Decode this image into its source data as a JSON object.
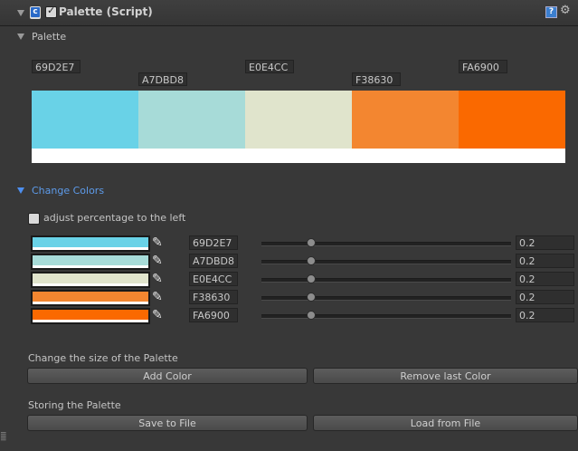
{
  "header": {
    "title": "Palette (Script)",
    "enabled": true,
    "icons": [
      "foldout-arrow",
      "script-icon",
      "help-icon",
      "gear-icon"
    ]
  },
  "palette_section": {
    "label": "Palette",
    "hex_labels": [
      "69D2E7",
      "A7DBD8",
      "E0E4CC",
      "F38630",
      "FA6900"
    ],
    "colors": [
      "#69D2E7",
      "#A7DBD8",
      "#E0E4CC",
      "#F38630",
      "#FA6900"
    ]
  },
  "change_colors": {
    "label": "Change Colors",
    "adjust_label": "adjust percentage to the left",
    "adjust_checked": false,
    "rows": [
      {
        "color": "#69D2E7",
        "hex": "69D2E7",
        "value": "0.2",
        "fraction": 0.2
      },
      {
        "color": "#A7DBD8",
        "hex": "A7DBD8",
        "value": "0.2",
        "fraction": 0.2
      },
      {
        "color": "#E0E4CC",
        "hex": "E0E4CC",
        "value": "0.2",
        "fraction": 0.2
      },
      {
        "color": "#F38630",
        "hex": "F38630",
        "value": "0.2",
        "fraction": 0.2
      },
      {
        "color": "#FA6900",
        "hex": "FA6900",
        "value": "0.2",
        "fraction": 0.2
      }
    ]
  },
  "size_section": {
    "label": "Change the size of the Palette",
    "add_label": "Add Color",
    "remove_label": "Remove last Color"
  },
  "store_section": {
    "label": "Storing the Palette",
    "save_label": "Save to File",
    "load_label": "Load from File"
  },
  "colors": {
    "background": "#383838",
    "accent_blue": "#5d9bea"
  }
}
